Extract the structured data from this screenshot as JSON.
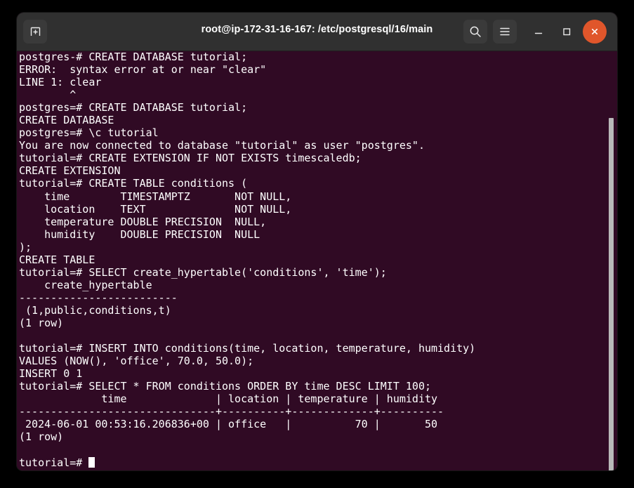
{
  "window": {
    "title": "root@ip-172-31-16-167: /etc/postgresql/16/main",
    "background_color": "#300a24",
    "titlebar_color": "#303030",
    "text_color": "#ffffff",
    "close_button_color": "#e0562b"
  },
  "titlebar": {
    "new_tab_label": "new-tab",
    "search_label": "search",
    "menu_label": "menu",
    "minimize_label": "minimize",
    "maximize_label": "maximize",
    "close_label": "close"
  },
  "terminal": {
    "prompt_current": "tutorial=# ",
    "cursor": "block",
    "lines": [
      "postgres-# CREATE DATABASE tutorial;",
      "ERROR:  syntax error at or near \"clear\"",
      "LINE 1: clear",
      "        ^",
      "postgres=# CREATE DATABASE tutorial;",
      "CREATE DATABASE",
      "postgres=# \\c tutorial",
      "You are now connected to database \"tutorial\" as user \"postgres\".",
      "tutorial=# CREATE EXTENSION IF NOT EXISTS timescaledb;",
      "CREATE EXTENSION",
      "tutorial=# CREATE TABLE conditions (",
      "    time        TIMESTAMPTZ       NOT NULL,",
      "    location    TEXT              NOT NULL,",
      "    temperature DOUBLE PRECISION  NULL,",
      "    humidity    DOUBLE PRECISION  NULL",
      ");",
      "CREATE TABLE",
      "tutorial=# SELECT create_hypertable('conditions', 'time');",
      "    create_hypertable",
      "-------------------------",
      " (1,public,conditions,t)",
      "(1 row)",
      "",
      "tutorial=# INSERT INTO conditions(time, location, temperature, humidity)",
      "VALUES (NOW(), 'office', 70.0, 50.0);",
      "INSERT 0 1",
      "tutorial=# SELECT * FROM conditions ORDER BY time DESC LIMIT 100;",
      "             time              | location | temperature | humidity",
      "-------------------------------+----------+-------------+----------",
      " 2024-06-01 00:53:16.206836+00 | office   |          70 |       50",
      "(1 row)",
      ""
    ]
  },
  "scrollbar": {
    "name": "vertical-scrollbar"
  }
}
